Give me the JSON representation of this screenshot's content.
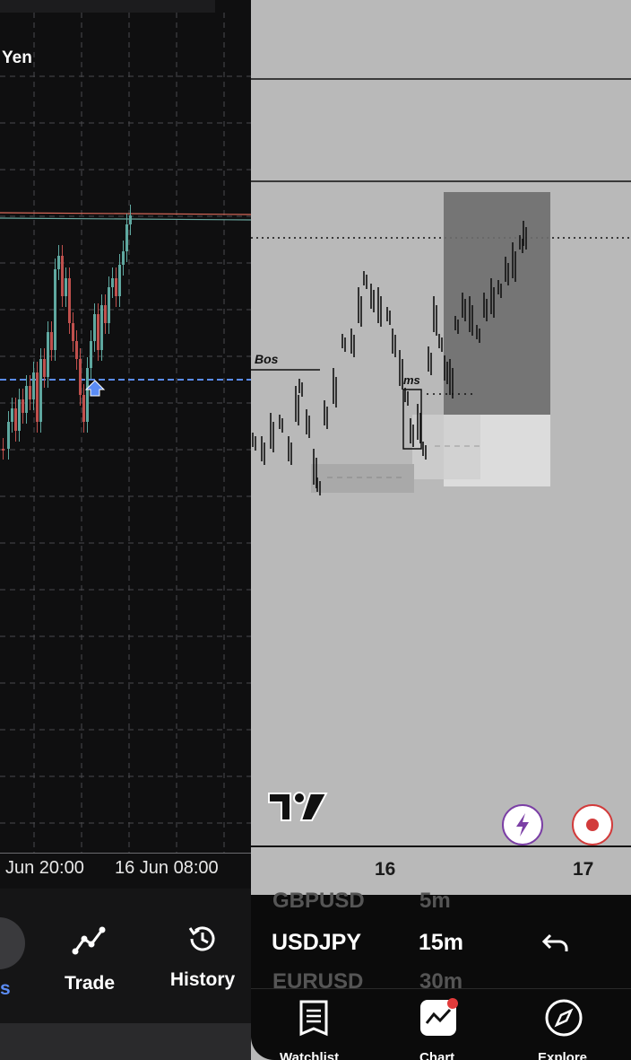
{
  "left_panel": {
    "symbol_title": "Yen",
    "time_labels": [
      "Jun 20:00",
      "16 Jun 08:00"
    ],
    "nav": {
      "partial_label": "s",
      "trade_label": "Trade",
      "history_label": "History"
    },
    "colors": {
      "bg": "#0f0f10",
      "bull": "#5fa8a0",
      "bear": "#c0504d",
      "accent": "#5b8cf5"
    }
  },
  "right_panel": {
    "annotations": {
      "bos": "Bos",
      "mss": "ms"
    },
    "x_axis_labels": [
      "16",
      "17"
    ],
    "picker": {
      "symbols": [
        "GBPUSD",
        "USDJPY",
        "EURUSD"
      ],
      "timeframes": [
        "5m",
        "15m",
        "30m"
      ],
      "selected_symbol": "USDJPY",
      "selected_timeframe": "15m"
    },
    "tabs": [
      "Watchlist",
      "Chart",
      "Explore"
    ],
    "icons": [
      "tradingview-logo",
      "lightning-icon",
      "record-icon",
      "undo-icon",
      "watchlist-icon",
      "chart-icon",
      "explore-icon"
    ],
    "colors": {
      "bg": "#b9b9b9",
      "zone_dark": "#6e6e6e",
      "zone_light": "#dcdcdc",
      "record": "#d23b3b",
      "lightning": "#7b3fa5"
    }
  }
}
